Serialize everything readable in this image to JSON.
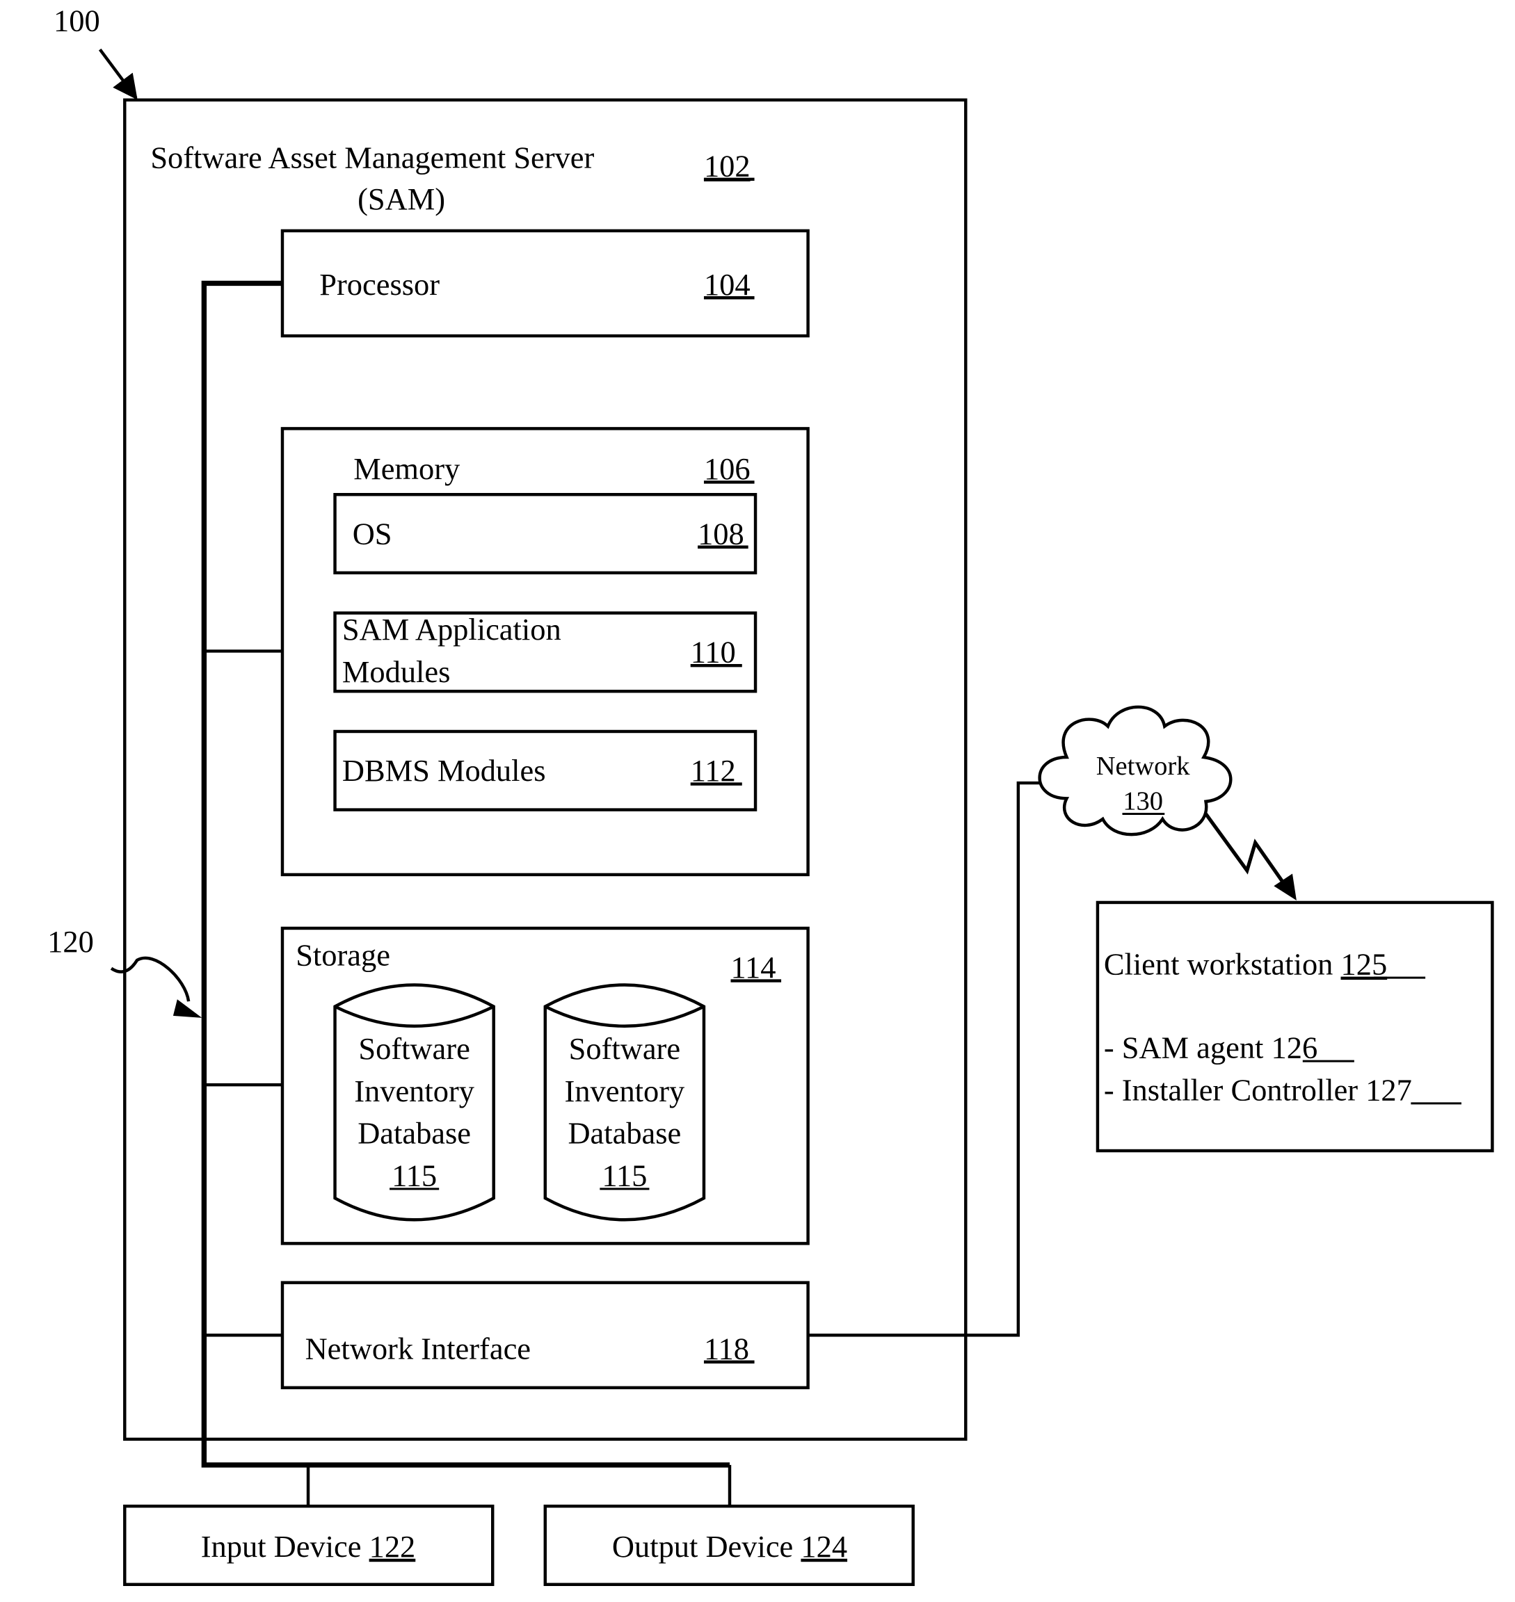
{
  "figure": {
    "ref_label": "100",
    "bus_label": "120"
  },
  "server": {
    "title_line1": "Software Asset Management  Server",
    "title_line2": "(SAM)",
    "ref": "102",
    "processor": {
      "label": "Processor",
      "ref": "104"
    },
    "memory": {
      "label": "Memory",
      "ref": "106",
      "items": [
        {
          "label_line1": "OS",
          "label_line2": "",
          "ref": "108"
        },
        {
          "label_line1": "SAM Application",
          "label_line2": "Modules",
          "ref": "110"
        },
        {
          "label_line1": "DBMS Modules",
          "label_line2": "",
          "ref": "112"
        }
      ]
    },
    "storage": {
      "label": "Storage",
      "ref": "114",
      "databases": [
        {
          "lines": [
            "Software",
            "Inventory",
            "Database"
          ],
          "ref": "115"
        },
        {
          "lines": [
            "Software",
            "Inventory",
            "Database"
          ],
          "ref": "115"
        }
      ]
    },
    "network_interface": {
      "label": "Network Interface",
      "ref": "118"
    }
  },
  "network": {
    "label": "Network",
    "ref": "130"
  },
  "client": {
    "title": "Client workstation ",
    "ref": "125",
    "items": [
      {
        "label": "- SAM agent  ",
        "ref": "126"
      },
      {
        "label": "- Installer Controller  ",
        "ref": "127"
      }
    ]
  },
  "input_device": {
    "label": "Input Device ",
    "ref": "122"
  },
  "output_device": {
    "label": "Output Device ",
    "ref": "124"
  }
}
